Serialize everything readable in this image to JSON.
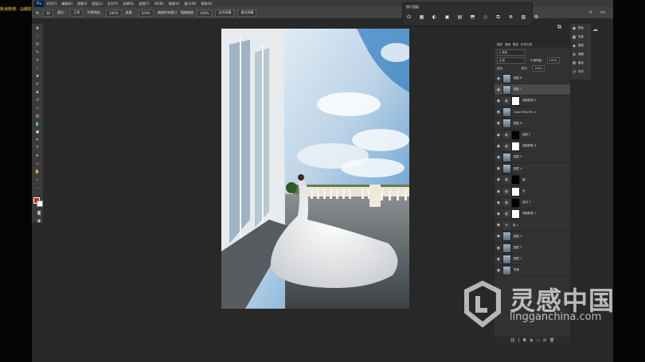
{
  "watermark_top": "新浪微博：@蝶影·一·记录 @数码影像后期设计工作室",
  "app": {
    "logo": "Ps"
  },
  "menu": [
    "文件(F)",
    "编辑(E)",
    "图像(I)",
    "图层(L)",
    "文字(Y)",
    "选择(S)",
    "滤镜(T)",
    "3D(D)",
    "视图(V)",
    "窗口(W)",
    "帮助(H)"
  ],
  "options": {
    "size": "30",
    "mode_label": "模式：",
    "mode_value": "正常",
    "opacity_label": "不透明度：",
    "opacity_value": "100%",
    "flow_label": "流量：",
    "flow_value": "100%",
    "sample_label": "缩放所有窗口",
    "scrubby_label": "细微缩放",
    "zoom_value": "100%",
    "fit_label": "适合屏幕",
    "fill_label": "填充屏幕"
  },
  "float_panel": {
    "title": "修片面板"
  },
  "mini_panels": [
    "颜色",
    "色板",
    "图层",
    "通道",
    "路径",
    "历史"
  ],
  "layers_panel": {
    "tabs": [
      "图层",
      "通道",
      "路径",
      "历史记录"
    ],
    "filter_label": "ρ 类型",
    "blend": "正常",
    "opacity_label": "不透明度：",
    "opacity": "100%",
    "lock_label": "锁定：",
    "fill_label": "填充：",
    "fill": "100%",
    "layers": [
      {
        "name": "图层 8",
        "type": "pixel"
      },
      {
        "name": "图层 7",
        "type": "pixel",
        "selected": true
      },
      {
        "name": "选取颜色 2",
        "type": "adjust"
      },
      {
        "name": "Color Efex Pro 4",
        "type": "pixel"
      },
      {
        "name": "图层 6",
        "type": "pixel"
      },
      {
        "name": "曲线 2",
        "type": "adjust"
      },
      {
        "name": "选取颜色 3",
        "type": "adjust"
      },
      {
        "name": "图层 5",
        "type": "pixel"
      },
      {
        "name": "图层 4",
        "type": "pixel"
      },
      {
        "name": "暗",
        "type": "adjust"
      },
      {
        "name": "亮",
        "type": "adjust"
      },
      {
        "name": "高光 1",
        "type": "adjust"
      },
      {
        "name": "选取颜色 1",
        "type": "adjust"
      },
      {
        "name": "组 1",
        "type": "group"
      },
      {
        "name": "图层 3",
        "type": "pixel"
      },
      {
        "name": "图层 2",
        "type": "pixel"
      },
      {
        "name": "图层 1",
        "type": "pixel"
      },
      {
        "name": "背景",
        "type": "pixel"
      }
    ]
  },
  "watermark": {
    "cn": "灵感中国",
    "en": "lingganchina.com"
  },
  "colors": {
    "foreground": "#d42020",
    "background": "#ffffff",
    "accent": "#31a8ff"
  }
}
